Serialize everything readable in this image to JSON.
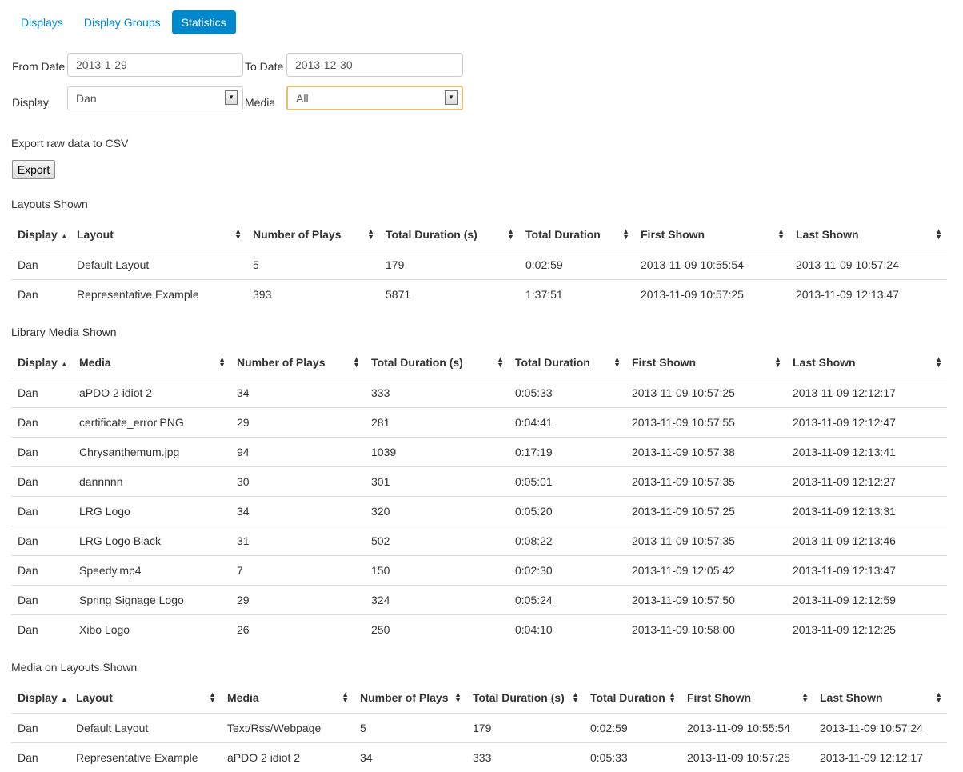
{
  "tabs": [
    {
      "label": "Displays",
      "active": false
    },
    {
      "label": "Display Groups",
      "active": false
    },
    {
      "label": "Statistics",
      "active": true
    }
  ],
  "filters": {
    "from_date_label": "From Date",
    "from_date_value": "2013-1-29",
    "to_date_label": "To Date",
    "to_date_value": "2013-12-30",
    "display_label": "Display",
    "display_value": "Dan",
    "media_label": "Media",
    "media_value": "All"
  },
  "export": {
    "text": "Export raw data to CSV",
    "button_label": "Export"
  },
  "layouts_shown": {
    "title": "Layouts Shown",
    "columns": [
      "Display",
      "Layout",
      "Number of Plays",
      "Total Duration (s)",
      "Total Duration",
      "First Shown",
      "Last Shown"
    ],
    "rows": [
      [
        "Dan",
        "Default Layout",
        "5",
        "179",
        "0:02:59",
        "2013-11-09 10:55:54",
        "2013-11-09 10:57:24"
      ],
      [
        "Dan",
        "Representative Example",
        "393",
        "5871",
        "1:37:51",
        "2013-11-09 10:57:25",
        "2013-11-09 12:13:47"
      ]
    ]
  },
  "library_media_shown": {
    "title": "Library Media Shown",
    "columns": [
      "Display",
      "Media",
      "Number of Plays",
      "Total Duration (s)",
      "Total Duration",
      "First Shown",
      "Last Shown"
    ],
    "rows": [
      [
        "Dan",
        "aPDO 2 idiot 2",
        "34",
        "333",
        "0:05:33",
        "2013-11-09 10:57:25",
        "2013-11-09 12:12:17"
      ],
      [
        "Dan",
        "certificate_error.PNG",
        "29",
        "281",
        "0:04:41",
        "2013-11-09 10:57:55",
        "2013-11-09 12:12:47"
      ],
      [
        "Dan",
        "Chrysanthemum.jpg",
        "94",
        "1039",
        "0:17:19",
        "2013-11-09 10:57:38",
        "2013-11-09 12:13:41"
      ],
      [
        "Dan",
        "dannnnn",
        "30",
        "301",
        "0:05:01",
        "2013-11-09 10:57:35",
        "2013-11-09 12:12:27"
      ],
      [
        "Dan",
        "LRG Logo",
        "34",
        "320",
        "0:05:20",
        "2013-11-09 10:57:25",
        "2013-11-09 12:13:31"
      ],
      [
        "Dan",
        "LRG Logo Black",
        "31",
        "502",
        "0:08:22",
        "2013-11-09 10:57:35",
        "2013-11-09 12:13:46"
      ],
      [
        "Dan",
        "Speedy.mp4",
        "7",
        "150",
        "0:02:30",
        "2013-11-09 12:05:42",
        "2013-11-09 12:13:47"
      ],
      [
        "Dan",
        "Spring Signage Logo",
        "29",
        "324",
        "0:05:24",
        "2013-11-09 10:57:50",
        "2013-11-09 12:12:59"
      ],
      [
        "Dan",
        "Xibo Logo",
        "26",
        "250",
        "0:04:10",
        "2013-11-09 10:58:00",
        "2013-11-09 12:12:25"
      ]
    ]
  },
  "media_on_layouts_shown": {
    "title": "Media on Layouts Shown",
    "columns": [
      "Display",
      "Layout",
      "Media",
      "Number of Plays",
      "Total Duration (s)",
      "Total Duration",
      "First Shown",
      "Last Shown"
    ],
    "rows": [
      [
        "Dan",
        "Default Layout",
        "Text/Rss/Webpage",
        "5",
        "179",
        "0:02:59",
        "2013-11-09 10:55:54",
        "2013-11-09 10:57:24"
      ],
      [
        "Dan",
        "Representative Example",
        "aPDO 2 idiot 2",
        "34",
        "333",
        "0:05:33",
        "2013-11-09 10:57:25",
        "2013-11-09 12:12:17"
      ]
    ]
  }
}
